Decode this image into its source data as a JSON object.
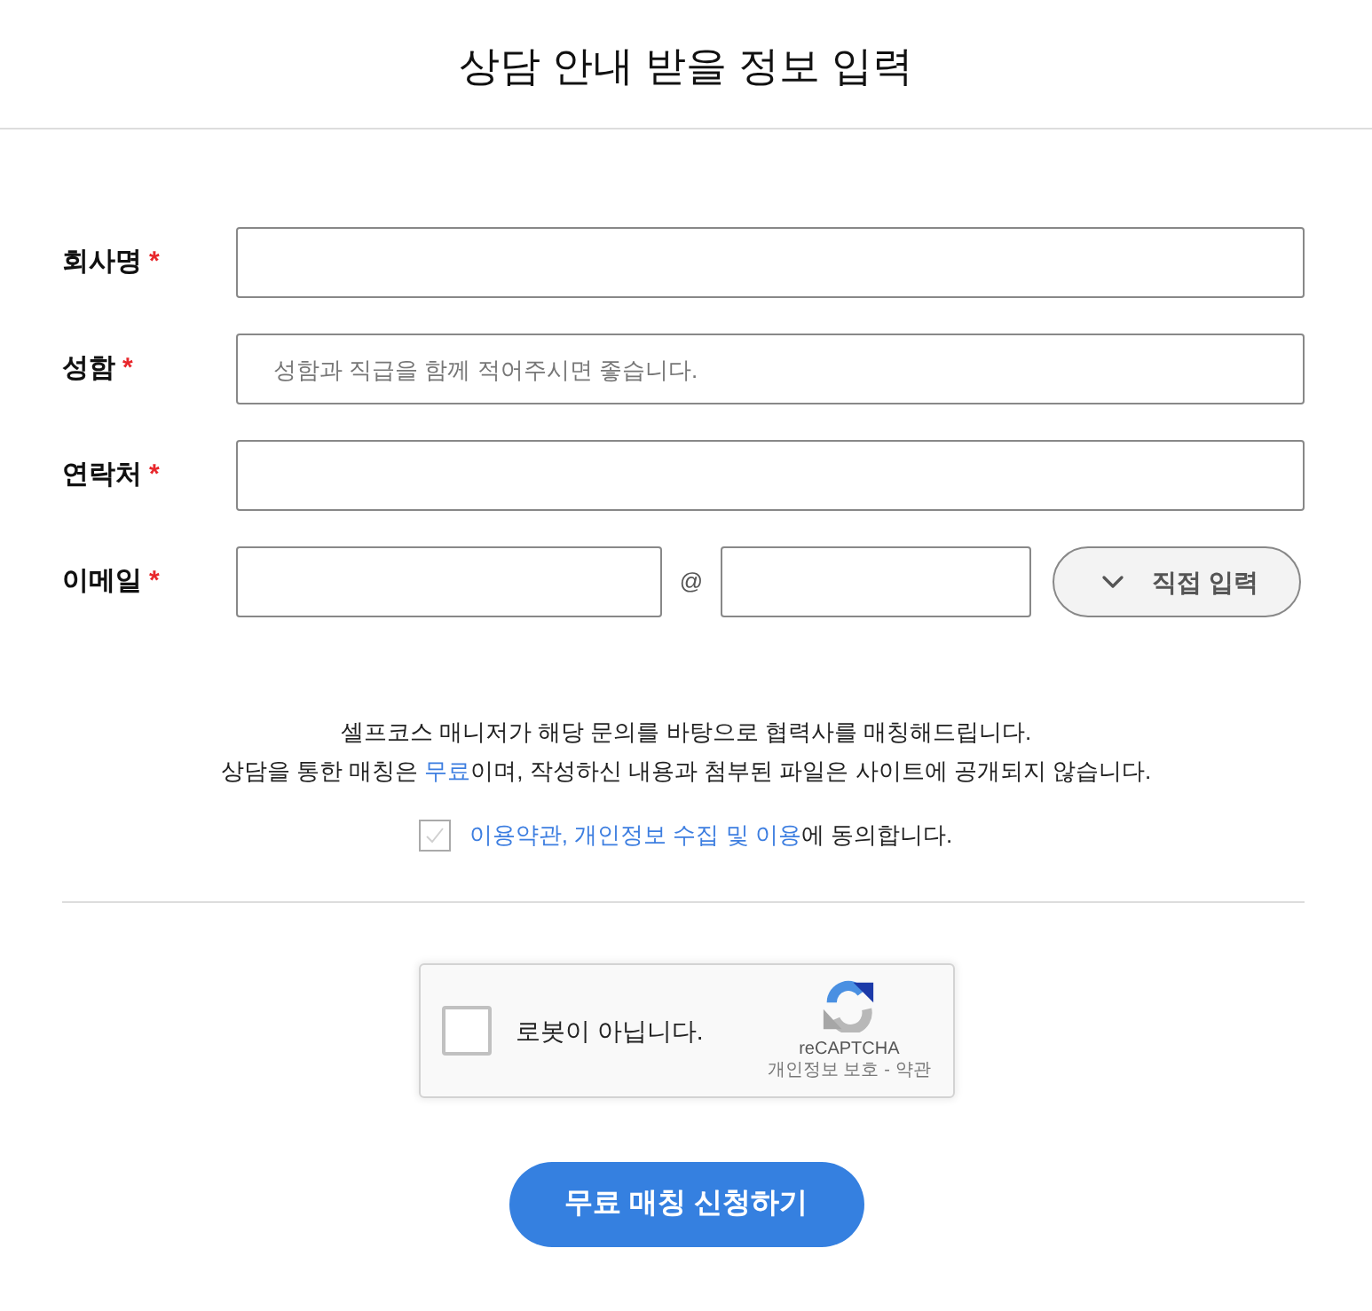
{
  "header": {
    "title": "상담 안내 받을 정보 입력"
  },
  "fields": [
    {
      "kind": "text",
      "label": "회사명",
      "required_mark": "*"
    },
    {
      "kind": "text",
      "label": "성함",
      "required_mark": "*",
      "placeholder": "성함과 직급을 함께 적어주시면 좋습니다."
    },
    {
      "kind": "text",
      "label": "연락처",
      "required_mark": "*"
    },
    {
      "kind": "email",
      "label": "이메일",
      "required_mark": "*",
      "separator": "@",
      "domain_button": "직접 입력"
    }
  ],
  "notice": {
    "lines": [
      [
        {
          "kind": "text",
          "text": "셀프코스 매니저가 해당 문의를 바탕으로 협력사를 매칭해드립니다."
        }
      ],
      [
        {
          "kind": "text",
          "text": "상담을 통한 매칭은 "
        },
        {
          "kind": "highlight",
          "text": "무료"
        },
        {
          "kind": "text",
          "text": "이며, 작성하신 내용과 첨부된 파일은 사이트에 공개되지 않습니다."
        }
      ]
    ]
  },
  "agreement": {
    "checked": false,
    "parts": [
      {
        "kind": "link",
        "text": "이용약관, 개인정보 수집 및 이용"
      },
      {
        "kind": "text",
        "text": "에 동의합니다."
      }
    ]
  },
  "captcha": {
    "checked": false,
    "label": "로봇이 아닙니다.",
    "brand": "reCAPTCHA",
    "links": [
      "개인정보 보호",
      "약관"
    ],
    "link_separator": "-"
  },
  "submit": {
    "label": "무료 매칭 신청하기"
  }
}
